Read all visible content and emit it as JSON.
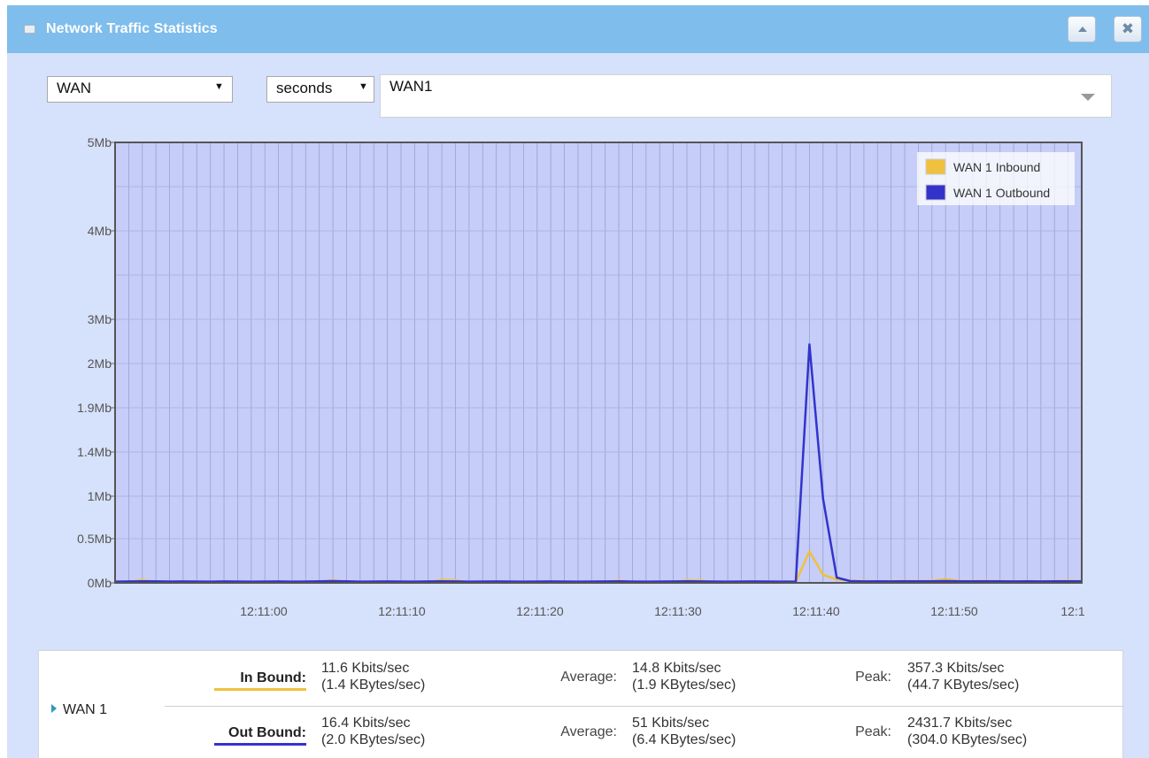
{
  "window": {
    "title": "Network Traffic Statistics",
    "collapse_icon": "collapse-up-icon",
    "close_label": "✖"
  },
  "controls": {
    "group_select": "WAN",
    "unit_select": "seconds",
    "interface_select": "WAN1"
  },
  "chart_data": {
    "type": "line",
    "y_tick_labels": [
      "5Mb",
      "4Mb",
      "3Mb",
      "2Mb",
      "1.9Mb",
      "1.4Mb",
      "1Mb",
      "0.5Mb",
      "0Mb"
    ],
    "x_tick_labels": [
      "12:11:00",
      "12:11:10",
      "12:11:20",
      "12:11:30",
      "12:11:40",
      "12:11:50",
      "12:1"
    ],
    "legend_position": "top-right",
    "grid": true,
    "series": [
      {
        "name": "WAN 1 Inbound",
        "color": "#f0c040",
        "values": [
          8,
          10,
          34,
          11,
          8,
          10,
          9,
          8,
          10,
          9,
          8,
          9,
          10,
          8,
          9,
          11,
          30,
          12,
          8,
          9,
          10,
          9,
          8,
          10,
          34,
          29,
          8,
          9,
          10,
          9,
          8,
          9,
          10,
          9,
          8,
          9,
          10,
          28,
          9,
          8,
          9,
          10,
          30,
          28,
          9,
          8,
          9,
          10,
          9,
          8,
          9,
          357,
          90,
          40,
          25,
          20,
          18,
          20,
          22,
          20,
          25,
          40,
          22,
          20,
          22,
          20,
          18,
          20,
          18,
          20,
          25,
          20
        ]
      },
      {
        "name": "WAN 1 Outbound",
        "color": "#3333cc",
        "values": [
          14,
          16,
          18,
          17,
          15,
          16,
          15,
          14,
          16,
          15,
          14,
          15,
          16,
          14,
          15,
          17,
          20,
          18,
          14,
          15,
          16,
          15,
          14,
          16,
          18,
          16,
          14,
          15,
          16,
          15,
          14,
          15,
          16,
          15,
          14,
          15,
          16,
          18,
          15,
          14,
          15,
          16,
          18,
          16,
          15,
          14,
          15,
          16,
          15,
          14,
          15,
          2431,
          970,
          60,
          20,
          16,
          17,
          16,
          18,
          17,
          17,
          20,
          18,
          17,
          18,
          17,
          16,
          17,
          16,
          17,
          18,
          17
        ]
      }
    ]
  },
  "stats": {
    "interface": "WAN 1",
    "inbound": {
      "label": "In Bound:",
      "current_kbits": "11.6 Kbits/sec",
      "current_kbytes": "(1.4 KBytes/sec)",
      "average_label": "Average:",
      "average_kbits": "14.8 Kbits/sec",
      "average_kbytes": "(1.9 KBytes/sec)",
      "peak_label": "Peak:",
      "peak_kbits": "357.3 Kbits/sec",
      "peak_kbytes": "(44.7 KBytes/sec)",
      "color": "#f0c040"
    },
    "outbound": {
      "label": "Out Bound:",
      "current_kbits": "16.4 Kbits/sec",
      "current_kbytes": "(2.0 KBytes/sec)",
      "average_label": "Average:",
      "average_kbits": "51 Kbits/sec",
      "average_kbytes": "(6.4 KBytes/sec)",
      "peak_label": "Peak:",
      "peak_kbits": "2431.7 Kbits/sec",
      "peak_kbytes": "(304.0 KBytes/sec)",
      "color": "#3333cc"
    }
  }
}
